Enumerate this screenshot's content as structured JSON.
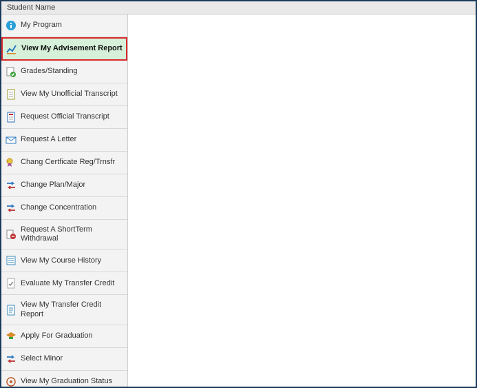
{
  "header": {
    "title": "Student Name"
  },
  "sidebar": {
    "items": [
      {
        "label": "My Program",
        "icon": "info-icon"
      },
      {
        "label": "View My Advisement Report",
        "icon": "chart-line-icon",
        "selected": true
      },
      {
        "label": "Grades/Standing",
        "icon": "grades-icon"
      },
      {
        "label": "View My Unofficial Transcript",
        "icon": "document-icon"
      },
      {
        "label": "Request Official Transcript",
        "icon": "document-request-icon"
      },
      {
        "label": "Request A Letter",
        "icon": "letter-icon"
      },
      {
        "label": "Chang Certficate Reg/Trnsfr",
        "icon": "certificate-icon"
      },
      {
        "label": "Change Plan/Major",
        "icon": "swap-icon"
      },
      {
        "label": "Change Concentration",
        "icon": "swap-icon"
      },
      {
        "label": "Request A ShortTerm Withdrawal",
        "icon": "withdrawal-icon"
      },
      {
        "label": "View My Course History",
        "icon": "history-icon"
      },
      {
        "label": "Evaluate My Transfer Credit",
        "icon": "evaluate-icon"
      },
      {
        "label": "View My Transfer Credit Report",
        "icon": "report-icon"
      },
      {
        "label": "Apply For Graduation",
        "icon": "graduation-icon"
      },
      {
        "label": "Select Minor",
        "icon": "swap-icon"
      },
      {
        "label": "View My Graduation Status",
        "icon": "status-icon"
      }
    ]
  }
}
